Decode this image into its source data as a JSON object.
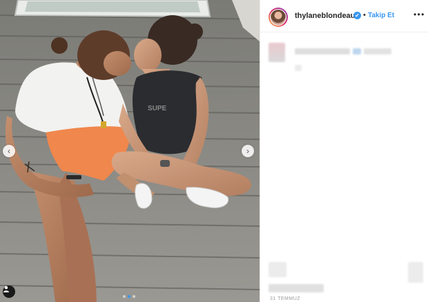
{
  "header": {
    "username": "thylaneblondeau",
    "verified_mark": "✔",
    "separator": "•",
    "follow_label": "Takip Et",
    "more_icon": "more-horizontal-icon"
  },
  "media": {
    "prev_arrow": "‹",
    "next_arrow": "›",
    "carousel_count": 3,
    "active_index": 2
  },
  "post": {
    "date": "31 TEMMUZ"
  },
  "colors": {
    "accent": "#3897f0",
    "text": "#262626",
    "muted": "#999999",
    "border": "#efefef"
  }
}
